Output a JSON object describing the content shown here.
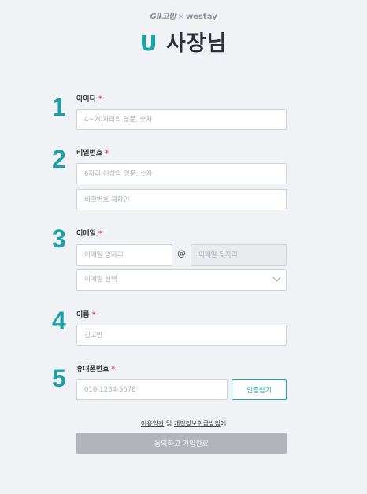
{
  "header": {
    "brand_gobang": "GⅡ고방",
    "brand_x": "×",
    "brand_westay": "westay",
    "logo_u": "U",
    "logo_text": "사장님"
  },
  "form": {
    "id": {
      "step": "1",
      "label": "아이디",
      "required_mark": "*",
      "placeholder": "4~20자리의 영문, 숫자"
    },
    "password": {
      "step": "2",
      "label": "비밀번호",
      "required_mark": "*",
      "placeholder": "6자리 이상의 영문, 숫자",
      "confirm_placeholder": "비밀번호 재확인"
    },
    "email": {
      "step": "3",
      "label": "이메일",
      "required_mark": "*",
      "local_placeholder": "이메일 앞자리",
      "at": "@",
      "domain_placeholder": "이메일 뒷자리",
      "select_text": "이메일 선택"
    },
    "name": {
      "step": "4",
      "label": "이름",
      "required_mark": "*",
      "placeholder": "김고방"
    },
    "phone": {
      "step": "5",
      "label": "휴대폰번호",
      "required_mark": "*",
      "placeholder": "010-1234-5678",
      "verify_label": "인증받기"
    }
  },
  "footer": {
    "terms_link": "이용약관",
    "and": " 및 ",
    "privacy_link": "개인정보취급방침",
    "suffix": "에",
    "submit_label": "동의하고 가입완료"
  }
}
